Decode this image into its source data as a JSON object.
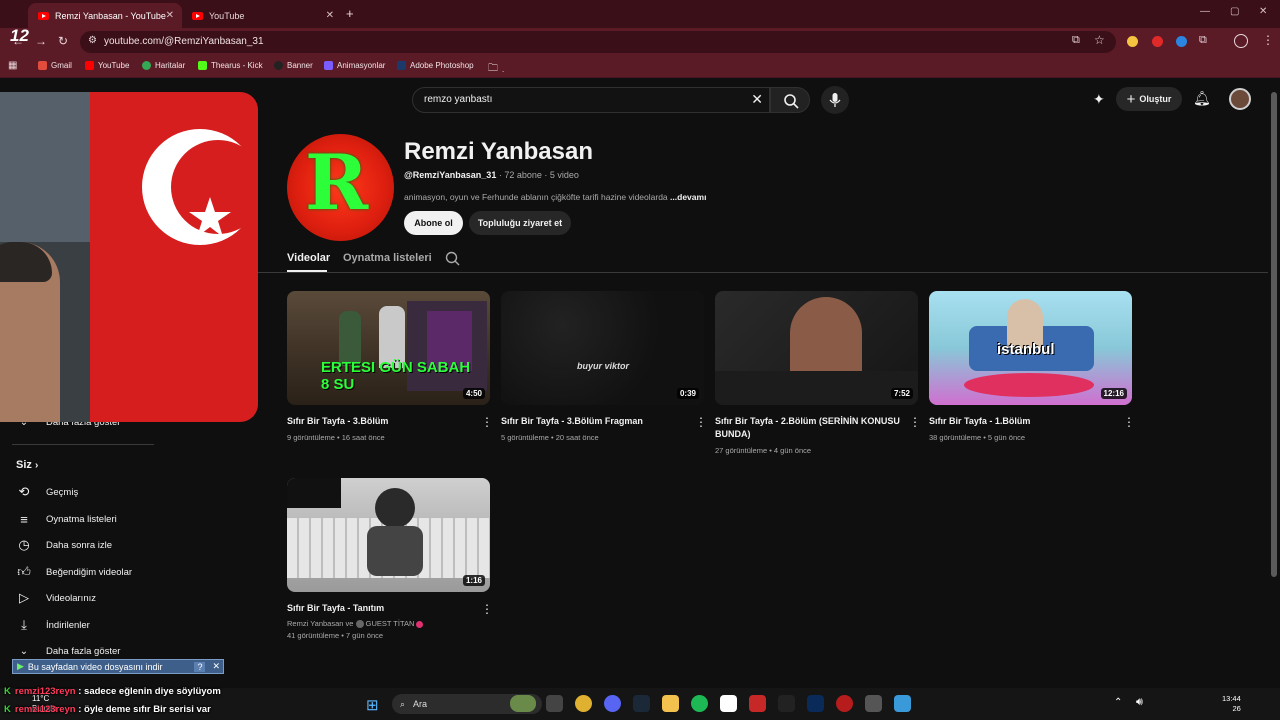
{
  "browser": {
    "tabs": [
      {
        "title": "Remzi Yanbasan - YouTube",
        "active": true
      },
      {
        "title": "YouTube",
        "active": false
      }
    ],
    "url": "youtube.com/@RemziYanbasan_31",
    "bookmarks": [
      "Gmail",
      "YouTube",
      "Haritalar",
      "Thearus - Kick",
      "Banner",
      "Animasyonlar",
      "Adobe Photoshop",
      "."
    ]
  },
  "youtube": {
    "search_value": "remzo yanbastı",
    "create_label": "Oluştur"
  },
  "channel": {
    "name": "Remzi Yanbasan",
    "handle": "@RemziYanbasan_31",
    "subscribers": "72 abone",
    "video_count": "5 video",
    "description": "animasyon, oyun ve Ferhunde ablanın çiğköfte tarifi hazine videolarda",
    "more": "...devamı",
    "subscribe_label": "Abone ol",
    "community_label": "Topluluğu ziyaret et",
    "tabs": [
      "Videolar",
      "Oynatma listeleri"
    ]
  },
  "videos": [
    {
      "title": "Sıfır Bir Tayfa - 3.Bölüm",
      "views": "9 görüntüleme",
      "age": "16 saat önce",
      "duration": "4:50",
      "thumb_text": "ERTESI GÜN SABAH 8 SU"
    },
    {
      "title": "Sıfır Bir Tayfa - 3.Bölüm Fragman",
      "views": "5 görüntüleme",
      "age": "20 saat önce",
      "duration": "0:39",
      "thumb_text": "buyur viktor"
    },
    {
      "title": "Sıfır Bir Tayfa - 2.Bölüm (SERİNİN KONUSU BUNDA)",
      "views": "27 görüntüleme",
      "age": "4 gün önce",
      "duration": "7:52"
    },
    {
      "title": "Sıfır Bir Tayfa - 1.Bölüm",
      "views": "38 görüntüleme",
      "age": "5 gün önce",
      "duration": "12:16",
      "thumb_text": "istanbul"
    },
    {
      "title": "Sıfır Bir Tayfa - Tanıtım",
      "authors": "Remzi Yanbasan ve",
      "guest": "GUEST TİTAN",
      "views": "41 görüntüleme",
      "age": "7 gün önce",
      "duration": "1:16"
    }
  ],
  "sidebar": {
    "more_top": "Daha fazla göster",
    "section": "Siz",
    "items": [
      {
        "label": "Geçmiş",
        "icon": "history-icon"
      },
      {
        "label": "Oynatma listeleri",
        "icon": "playlists-icon"
      },
      {
        "label": "Daha sonra izle",
        "icon": "watch-later-icon"
      },
      {
        "label": "Beğendiğim videolar",
        "icon": "liked-icon"
      },
      {
        "label": "Videolarınız",
        "icon": "your-videos-icon"
      },
      {
        "label": "İndirilenler",
        "icon": "downloads-icon"
      },
      {
        "label": "Daha fazla göster",
        "icon": "chevron-down-icon"
      }
    ]
  },
  "overlay": {
    "download_bar": "Bu sayfadan video dosyasını indir",
    "chat": [
      {
        "user": "remzi123reyn",
        "message": ": sadece eğlenin diye söylüyom"
      },
      {
        "user": "remzi123reyn",
        "message": ": öyle deme sıfır Bir serisi var"
      }
    ],
    "webcam_logo": "12"
  },
  "taskbar": {
    "search": "Ara",
    "weather_temp": "11°C",
    "weather_desc": "Bulutlu",
    "time": "13:44",
    "date": "26"
  }
}
